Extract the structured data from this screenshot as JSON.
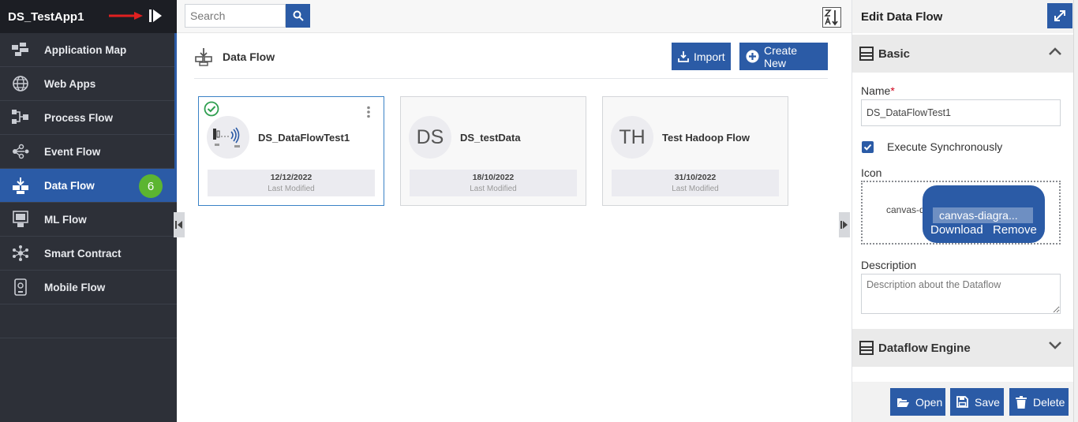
{
  "sidebar": {
    "app_title": "DS_TestApp1",
    "items": [
      {
        "label": "Application Map",
        "icon": "application-map-icon"
      },
      {
        "label": "Web Apps",
        "icon": "globe-icon"
      },
      {
        "label": "Process Flow",
        "icon": "process-flow-icon"
      },
      {
        "label": "Event Flow",
        "icon": "event-flow-icon"
      },
      {
        "label": "Data Flow",
        "icon": "data-flow-icon",
        "active": true,
        "badge": "6"
      },
      {
        "label": "ML Flow",
        "icon": "ml-flow-icon"
      },
      {
        "label": "Smart Contract",
        "icon": "smart-contract-icon"
      },
      {
        "label": "Mobile Flow",
        "icon": "mobile-flow-icon"
      }
    ]
  },
  "toolbar": {
    "search_placeholder": "Search"
  },
  "section": {
    "title": "Data Flow",
    "import_label": "Import",
    "create_label": "Create New"
  },
  "cards": [
    {
      "name": "DS_DataFlowTest1",
      "avatar": "",
      "date": "12/12/2022",
      "last_modified_label": "Last Modified",
      "selected": true
    },
    {
      "name": "DS_testData",
      "avatar": "DS",
      "date": "18/10/2022",
      "last_modified_label": "Last Modified"
    },
    {
      "name": "Test Hadoop Flow",
      "avatar": "TH",
      "date": "31/10/2022",
      "last_modified_label": "Last Modified"
    }
  ],
  "panel": {
    "title": "Edit Data Flow",
    "basic_label": "Basic",
    "name_label": "Name",
    "name_required": "*",
    "name_value": "DS_DataFlowTest1",
    "execute_label": "Execute Synchronously",
    "execute_checked": true,
    "icon_label": "Icon",
    "icon_file_bg": "canvas-d",
    "icon_file_name": "canvas-diagra...",
    "download_label": "Download",
    "remove_label": "Remove",
    "description_label": "Description",
    "description_placeholder": "Description about the Dataflow",
    "engine_label": "Dataflow Engine",
    "open_label": "Open",
    "save_label": "Save",
    "delete_label": "Delete"
  },
  "colors": {
    "accent": "#2b5ba6",
    "sidebar_bg": "#2d3038",
    "badge": "#5cb531"
  }
}
